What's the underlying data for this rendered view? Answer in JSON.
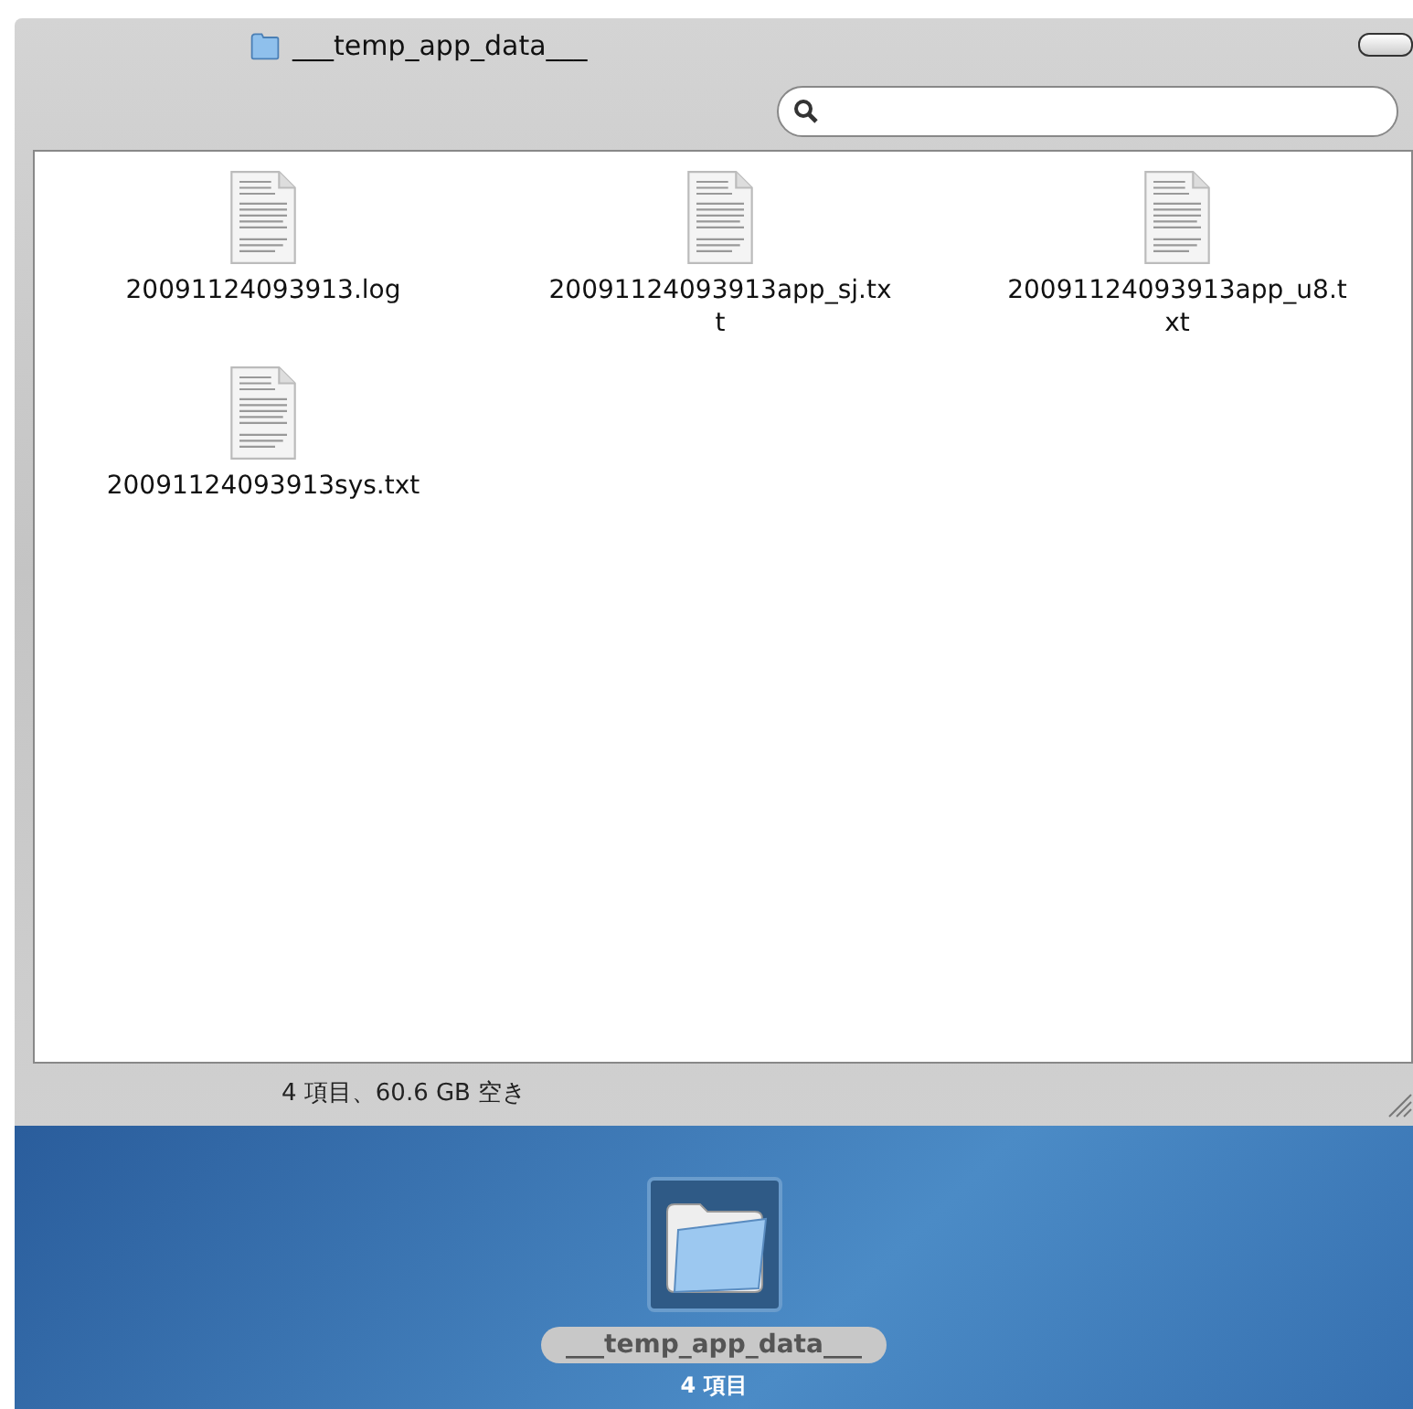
{
  "window": {
    "title": "___temp_app_data___"
  },
  "files": [
    {
      "name_lines": [
        "20091124093913.log"
      ]
    },
    {
      "name_lines": [
        "20091124093913app_sj.tx",
        "t"
      ]
    },
    {
      "name_lines": [
        "20091124093913app_u8.t",
        "xt"
      ]
    },
    {
      "name_lines": [
        "20091124093913sys.txt"
      ]
    }
  ],
  "status_bar": "4 項目、60.6 GB 空き",
  "desktop_item": {
    "name": "___temp_app_data___",
    "info": "4 項目",
    "selected": true
  }
}
